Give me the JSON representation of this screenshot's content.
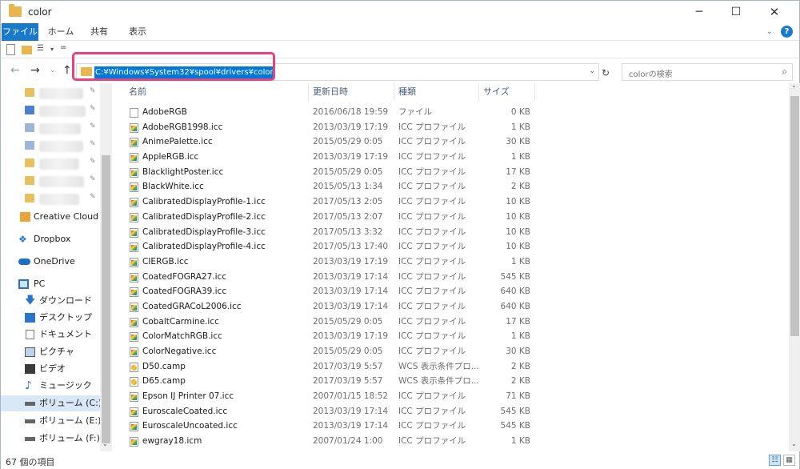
{
  "window": {
    "title": "color"
  },
  "ribbon": {
    "tabs": [
      "ファイル",
      "ホーム",
      "共有",
      "表示"
    ]
  },
  "address": {
    "path": "C:¥Windows¥System32¥spool¥drivers¥color",
    "search_placeholder": "colorの検索"
  },
  "navpane": {
    "items": [
      {
        "label": "Creative Cloud Files",
        "icon": "creative-cloud-icon"
      },
      {
        "label": "Dropbox",
        "icon": "dropbox-icon"
      },
      {
        "label": "OneDrive",
        "icon": "onedrive-icon"
      },
      {
        "label": "PC",
        "icon": "pc-icon"
      },
      {
        "label": "ダウンロード",
        "icon": "download-icon"
      },
      {
        "label": "デスクトップ",
        "icon": "desktop-icon"
      },
      {
        "label": "ドキュメント",
        "icon": "documents-icon"
      },
      {
        "label": "ピクチャ",
        "icon": "pictures-icon"
      },
      {
        "label": "ビデオ",
        "icon": "videos-icon"
      },
      {
        "label": "ミュージック",
        "icon": "music-icon"
      },
      {
        "label": "ボリューム (C:)",
        "icon": "drive-icon"
      },
      {
        "label": "ボリューム (E:)",
        "icon": "drive-icon"
      },
      {
        "label": "ボリューム (F:)",
        "icon": "drive-icon"
      }
    ]
  },
  "columns": {
    "name": "名前",
    "date": "更新日時",
    "type": "種類",
    "size": "サイズ"
  },
  "files": [
    {
      "name": "AdobeRGB",
      "date": "2016/06/18 19:59",
      "type": "ファイル",
      "size": "0 KB",
      "icon": "file"
    },
    {
      "name": "AdobeRGB1998.icc",
      "date": "2013/03/19 17:19",
      "type": "ICC プロファイル",
      "size": "1 KB",
      "icon": "icc"
    },
    {
      "name": "AnimePalette.icc",
      "date": "2015/05/29 0:05",
      "type": "ICC プロファイル",
      "size": "30 KB",
      "icon": "icc"
    },
    {
      "name": "AppleRGB.icc",
      "date": "2013/03/19 17:19",
      "type": "ICC プロファイル",
      "size": "1 KB",
      "icon": "icc"
    },
    {
      "name": "BlacklightPoster.icc",
      "date": "2015/05/29 0:05",
      "type": "ICC プロファイル",
      "size": "17 KB",
      "icon": "icc"
    },
    {
      "name": "BlackWhite.icc",
      "date": "2015/05/13 1:34",
      "type": "ICC プロファイル",
      "size": "2 KB",
      "icon": "icc"
    },
    {
      "name": "CalibratedDisplayProfile-1.icc",
      "date": "2017/05/13 2:05",
      "type": "ICC プロファイル",
      "size": "10 KB",
      "icon": "icc"
    },
    {
      "name": "CalibratedDisplayProfile-2.icc",
      "date": "2017/05/13 2:07",
      "type": "ICC プロファイル",
      "size": "10 KB",
      "icon": "icc"
    },
    {
      "name": "CalibratedDisplayProfile-3.icc",
      "date": "2017/05/13 3:32",
      "type": "ICC プロファイル",
      "size": "10 KB",
      "icon": "icc"
    },
    {
      "name": "CalibratedDisplayProfile-4.icc",
      "date": "2017/05/13 17:40",
      "type": "ICC プロファイル",
      "size": "10 KB",
      "icon": "icc"
    },
    {
      "name": "CIERGB.icc",
      "date": "2013/03/19 17:19",
      "type": "ICC プロファイル",
      "size": "1 KB",
      "icon": "icc"
    },
    {
      "name": "CoatedFOGRA27.icc",
      "date": "2013/03/19 17:14",
      "type": "ICC プロファイル",
      "size": "545 KB",
      "icon": "icc"
    },
    {
      "name": "CoatedFOGRA39.icc",
      "date": "2013/03/19 17:14",
      "type": "ICC プロファイル",
      "size": "640 KB",
      "icon": "icc"
    },
    {
      "name": "CoatedGRACoL2006.icc",
      "date": "2013/03/19 17:14",
      "type": "ICC プロファイル",
      "size": "640 KB",
      "icon": "icc"
    },
    {
      "name": "CobaltCarmine.icc",
      "date": "2015/05/29 0:05",
      "type": "ICC プロファイル",
      "size": "17 KB",
      "icon": "icc"
    },
    {
      "name": "ColorMatchRGB.icc",
      "date": "2013/03/19 17:19",
      "type": "ICC プロファイル",
      "size": "1 KB",
      "icon": "icc"
    },
    {
      "name": "ColorNegative.icc",
      "date": "2015/05/29 0:05",
      "type": "ICC プロファイル",
      "size": "30 KB",
      "icon": "icc"
    },
    {
      "name": "D50.camp",
      "date": "2017/03/19 5:57",
      "type": "WCS 表示条件プロ...",
      "size": "2 KB",
      "icon": "camp"
    },
    {
      "name": "D65.camp",
      "date": "2017/03/19 5:57",
      "type": "WCS 表示条件プロ...",
      "size": "2 KB",
      "icon": "camp"
    },
    {
      "name": "Epson IJ Printer 07.icc",
      "date": "2007/01/15 18:52",
      "type": "ICC プロファイル",
      "size": "71 KB",
      "icon": "icc"
    },
    {
      "name": "EuroscaleCoated.icc",
      "date": "2013/03/19 17:14",
      "type": "ICC プロファイル",
      "size": "545 KB",
      "icon": "icc"
    },
    {
      "name": "EuroscaleUncoated.icc",
      "date": "2013/03/19 17:14",
      "type": "ICC プロファイル",
      "size": "545 KB",
      "icon": "icc"
    },
    {
      "name": "ewgray18.icm",
      "date": "2007/01/24 1:00",
      "type": "ICC プロファイル",
      "size": "1 KB",
      "icon": "icc"
    }
  ],
  "status": {
    "item_count": "67 個の項目"
  },
  "colors": {
    "accent": "#1979ca",
    "highlight_box": "#e9417a",
    "selection": "#0078d7"
  }
}
